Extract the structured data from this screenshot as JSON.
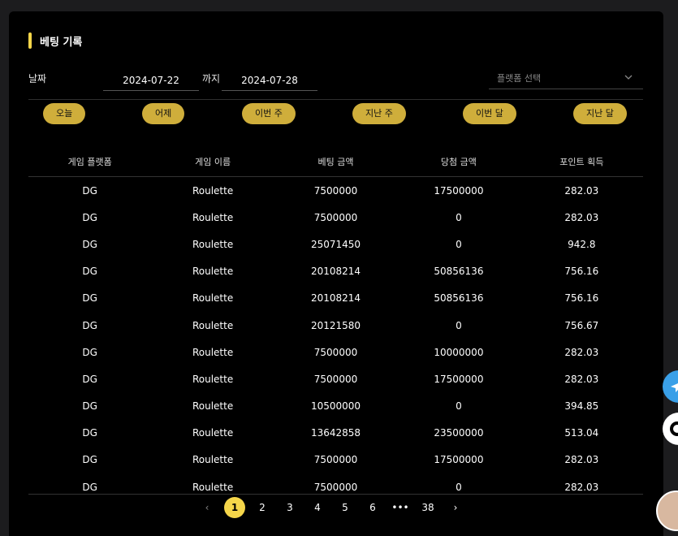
{
  "page_title": "베팅 기록",
  "filter": {
    "date_label": "날짜",
    "start_date": "2024-07-22",
    "until_label": "까지",
    "end_date": "2024-07-28",
    "platform_placeholder": "플랫폼 선택"
  },
  "quick_buttons": [
    "오늘",
    "어제",
    "이번 주",
    "지난 주",
    "이번 달",
    "지난 달"
  ],
  "table": {
    "headers": [
      "게임 플랫폼",
      "게임 이름",
      "베팅 금액",
      "당첨 금액",
      "포인트 획득"
    ],
    "rows": [
      [
        "DG",
        "Roulette",
        "7500000",
        "17500000",
        "282.03"
      ],
      [
        "DG",
        "Roulette",
        "7500000",
        "0",
        "282.03"
      ],
      [
        "DG",
        "Roulette",
        "25071450",
        "0",
        "942.8"
      ],
      [
        "DG",
        "Roulette",
        "20108214",
        "50856136",
        "756.16"
      ],
      [
        "DG",
        "Roulette",
        "20108214",
        "50856136",
        "756.16"
      ],
      [
        "DG",
        "Roulette",
        "20121580",
        "0",
        "756.67"
      ],
      [
        "DG",
        "Roulette",
        "7500000",
        "10000000",
        "282.03"
      ],
      [
        "DG",
        "Roulette",
        "7500000",
        "17500000",
        "282.03"
      ],
      [
        "DG",
        "Roulette",
        "10500000",
        "0",
        "394.85"
      ],
      [
        "DG",
        "Roulette",
        "13642858",
        "23500000",
        "513.04"
      ],
      [
        "DG",
        "Roulette",
        "7500000",
        "17500000",
        "282.03"
      ],
      [
        "DG",
        "Roulette",
        "7500000",
        "0",
        "282.03"
      ]
    ]
  },
  "pagination": {
    "prev": "‹",
    "pages": [
      "1",
      "2",
      "3",
      "4",
      "5",
      "6"
    ],
    "ellipsis": "•••",
    "last": "38",
    "next": "›",
    "current": "1"
  },
  "colors": {
    "accent": "#f5d64a",
    "button": "#cfae3b",
    "background": "#000000",
    "telegram": "#3aa0e8"
  },
  "icons": {
    "telegram": "telegram-icon",
    "kakao": "kakaotalk-icon",
    "support": "support-avatar"
  }
}
